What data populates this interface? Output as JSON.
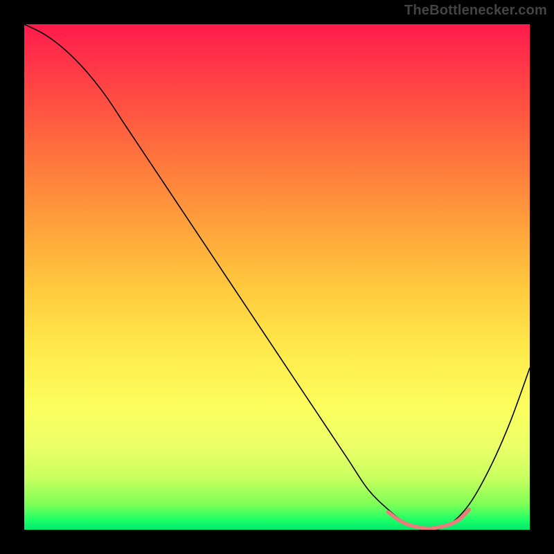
{
  "watermark": "TheBottlenecker.com",
  "chart_data": {
    "type": "line",
    "title": "",
    "xlabel": "",
    "ylabel": "",
    "xlim": [
      0,
      100
    ],
    "ylim": [
      0,
      100
    ],
    "grid": false,
    "legend": false,
    "annotations": [],
    "series": [
      {
        "name": "bottleneck-curve",
        "color": "#000000",
        "x": [
          0,
          4,
          8,
          12,
          16,
          20,
          24,
          28,
          32,
          36,
          40,
          44,
          48,
          52,
          56,
          60,
          64,
          68,
          72,
          76,
          80,
          84,
          88,
          92,
          96,
          100
        ],
        "y": [
          100,
          98,
          95,
          91,
          86,
          80,
          74,
          68,
          62,
          56,
          50,
          44,
          38,
          32,
          26,
          20,
          14,
          8,
          4,
          1,
          0,
          1,
          5,
          12,
          21,
          32
        ]
      },
      {
        "name": "optimal-range-highlight",
        "color": "#e97c7c",
        "x": [
          72,
          74,
          76,
          78,
          80,
          82,
          84,
          86,
          88
        ],
        "y": [
          3.5,
          2,
          1,
          0.5,
          0.2,
          0.5,
          1,
          2,
          4
        ]
      }
    ],
    "background_gradient": {
      "direction": "top-to-bottom",
      "stops": [
        {
          "pos": 0.0,
          "color": "#ff1a4d"
        },
        {
          "pos": 0.5,
          "color": "#ffc43d"
        },
        {
          "pos": 0.8,
          "color": "#f3ff5e"
        },
        {
          "pos": 1.0,
          "color": "#00e86e"
        }
      ]
    }
  }
}
